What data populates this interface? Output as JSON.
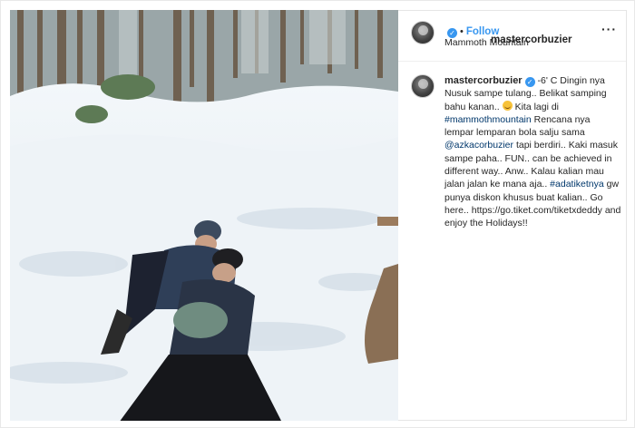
{
  "post": {
    "photo_description_icon": "snow-photo",
    "accent_color": "#3897f0"
  },
  "header": {
    "username": "mastercorbuzier",
    "separator": "•",
    "follow_label": "Follow",
    "location": "Mammoth Mountain",
    "more_label": "···"
  },
  "caption": {
    "username": "mastercorbuzier",
    "text_1": "-6' C Dingin nya Nusuk sampe tulang.. Belikat samping bahu kanan..",
    "text_2": "Kita lagi di",
    "hashtag_1": "#mammothmountain",
    "text_3": "Rencana nya lempar lemparan bola salju sama",
    "mention_1": "@azkacorbuzier",
    "text_4": "tapi berdiri.. Kaki masuk sampe paha.. FUN.. can be achieved in different way.. Anw.. Kalau kalian mau jalan jalan ke mana aja..",
    "hashtag_2": "#adatiketnya",
    "text_5": "gw punya diskon khusus buat kalian.. Go here.. https://go.tiket.com/tiketxdeddy and enjoy the Holidays!!"
  }
}
